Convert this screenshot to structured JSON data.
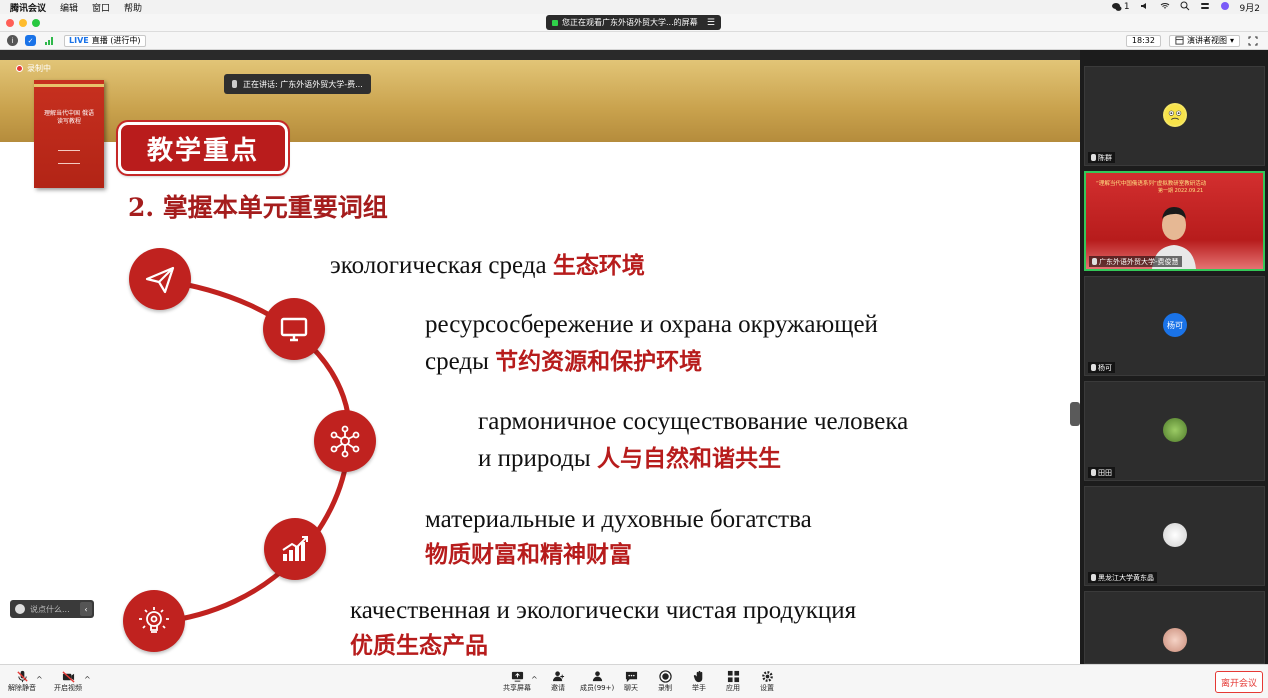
{
  "menubar": {
    "app_name": "腾讯会议",
    "items": [
      "编辑",
      "窗口",
      "帮助"
    ],
    "notif_count": "1",
    "date_short": "9月2"
  },
  "titlebar": {
    "sharing_text": "您正在观看广东外语外贸大学...的屏幕"
  },
  "toolbar": {
    "live_label": "LIVE",
    "live_status": "直播 (进行中)",
    "time": "18:32",
    "view_mode": "演讲者视图"
  },
  "slide": {
    "recording_label": "录制中",
    "speaking_label": "正在讲话: 广东外语外贸大学-费...",
    "book_title": "理解当代中国 俄语读写教程",
    "badge_title": "教学重点",
    "subtitle": "2. 掌握本单元重要词组",
    "phrases": [
      {
        "ru": "экологическая среда ",
        "cn": "生态环境"
      },
      {
        "ru1": "ресурсосбережение и охрана окружающей",
        "ru2": "среды ",
        "cn": "节约资源和保护环境"
      },
      {
        "ru1": "гармоничное  сосуществование  человека",
        "ru2": "и природы ",
        "cn": "人与自然和谐共生"
      },
      {
        "ru": "материальные и духовные богатства",
        "cn": "物质财富和精神财富"
      },
      {
        "ru": "качественная и экологически чистая продукция",
        "cn": "优质生态产品"
      }
    ],
    "icons": [
      "paper-plane-icon",
      "monitor-icon",
      "network-icon",
      "growth-chart-icon",
      "lightbulb-gear-icon"
    ],
    "accent": "#c0221f"
  },
  "chat": {
    "placeholder": "说点什么..."
  },
  "participants": [
    {
      "name": "陈群",
      "avatar_type": "emoji"
    },
    {
      "name": "广东外语外贸大学-费俊慧",
      "video": true,
      "banner": "“理解当代中国俄语系列”虚拟教研室教研活动",
      "banner_sub": "第一期 2022.09.21"
    },
    {
      "name": "杨可",
      "avatar_text": "杨可",
      "avatar_color": "#1a73e8"
    },
    {
      "name": "田田",
      "avatar_type": "photo"
    },
    {
      "name": "黑龙江大学黄东晶",
      "avatar_type": "photo"
    },
    {
      "name": "",
      "avatar_type": "photo"
    }
  ],
  "bottombar": {
    "mute": "解除静音",
    "video": "开启视频",
    "share": "共享屏幕",
    "invite": "邀请",
    "members": "成员(99+)",
    "chat": "聊天",
    "record": "录制",
    "raise_hand": "举手",
    "apps": "应用",
    "settings": "设置",
    "leave": "离开会议"
  }
}
